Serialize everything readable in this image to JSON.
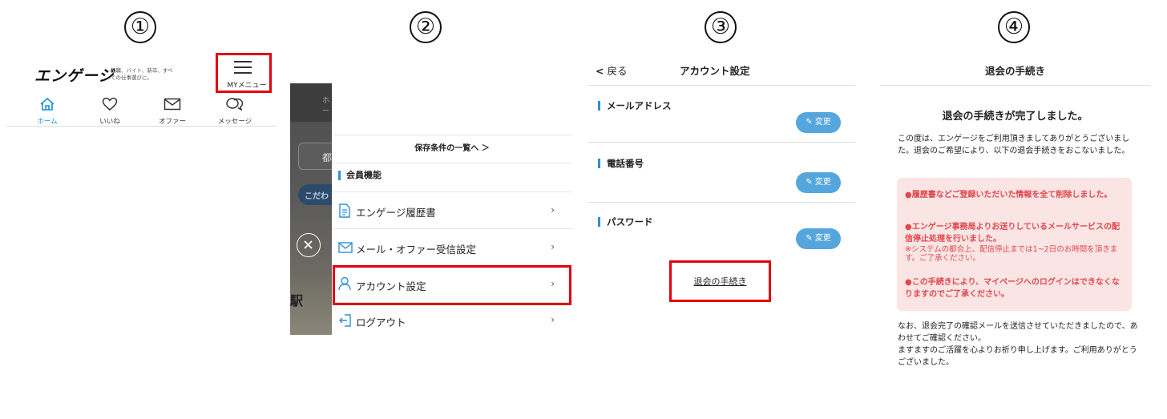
{
  "steps": [
    "①",
    "②",
    "③",
    "④"
  ],
  "panel1": {
    "logo": "エンゲージ",
    "tagline": "転職、バイト、新卒、すべての仕事選びに。",
    "menu_label": "MYメニュー",
    "nav": [
      {
        "label": "ホーム",
        "icon": "home-icon"
      },
      {
        "label": "いいね",
        "icon": "heart-icon"
      },
      {
        "label": "オファー",
        "icon": "mail-icon"
      },
      {
        "label": "メッセージ",
        "icon": "chat-icon"
      }
    ],
    "highlight_color": "#e00010",
    "accent_color": "#1a8fd8"
  },
  "panel2": {
    "saved_link": "保存条件の一覧へ ＞",
    "section_title": "会員機能",
    "items": [
      {
        "label": "エンゲージ履歴書",
        "icon": "document-icon"
      },
      {
        "label": "メール・オファー受信設定",
        "icon": "mail-icon"
      },
      {
        "label": "アカウント設定",
        "icon": "user-icon"
      },
      {
        "label": "ログアウト",
        "icon": "logout-icon"
      }
    ],
    "map_labels": {
      "home_fragment": "ホー",
      "search_fragment": "都",
      "chip_fragment": "こだわ",
      "station_fragment": "駅"
    }
  },
  "panel3": {
    "back_label": "戻る",
    "title": "アカウント設定",
    "sections": [
      {
        "label": "メールアドレス",
        "button": "変更"
      },
      {
        "label": "電話番号",
        "button": "変更"
      },
      {
        "label": "パスワード",
        "button": "変更"
      }
    ],
    "withdraw_link": "退会の手続き"
  },
  "panel4": {
    "title": "退会の手続き",
    "heading": "退会の手続きが完了しました。",
    "intro": "この度は、エンゲージをご利用頂きましてありがとうございました。退会のご希望により、以下の退会手続きをおこないました。",
    "notice_items": [
      {
        "text": "●履歴書などご登録いただいた情報を全て削除しました。",
        "note": ""
      },
      {
        "text": "●エンゲージ事務局よりお送りしているメールサービスの配信停止処理を行いました。",
        "note": "※システムの都合上、配信停止までは1~2日のお時間を頂きます。ご了承ください。"
      },
      {
        "text": "●この手続きにより、マイページへのログインはできなくなりますのでご了承ください。",
        "note": ""
      }
    ],
    "footer_1": "なお、退会完了の確認メールを送信させていただきましたので、あわせてご確認ください。",
    "footer_2": "ますますのご活躍を心よりお祈り申し上げます。ご利用ありがとうございました。"
  }
}
